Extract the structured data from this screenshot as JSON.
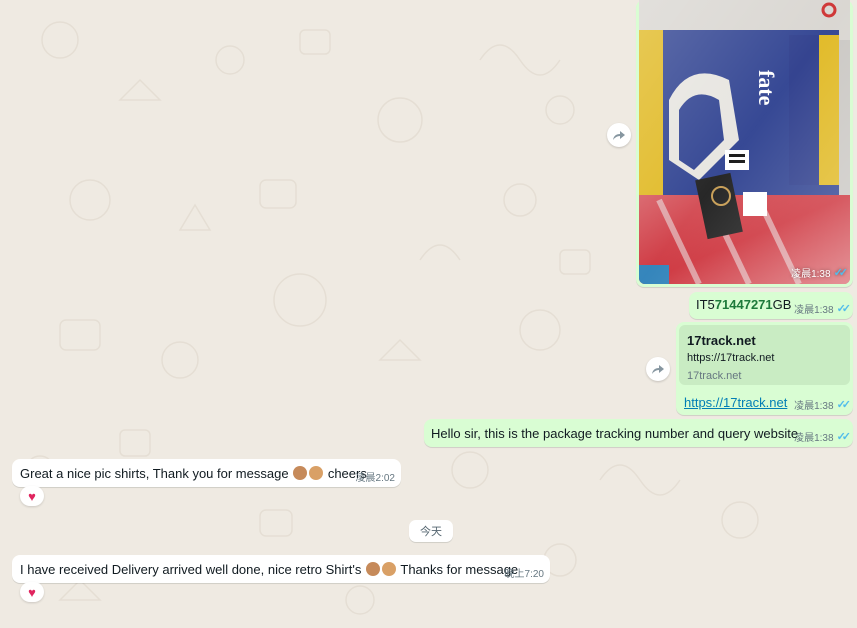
{
  "colors": {
    "outgoing": "#d9fdd3",
    "incoming": "#ffffff",
    "background": "#efeae2",
    "read_ticks": "#53bdeb",
    "link": "#027eb5"
  },
  "image_message": {
    "time": "凌晨1:38"
  },
  "tracking_message": {
    "prefix": "IT5",
    "number": "71447271",
    "suffix": "GB",
    "time": "凌晨1:38"
  },
  "link_preview": {
    "title": "17track.net",
    "url": "https://17track.net",
    "domain": "17track.net"
  },
  "link_message": {
    "link": "https://17track.net",
    "time": "凌晨1:38"
  },
  "greeting_message": {
    "text": "Hello sir, this is the package tracking number and query website",
    "time": "凌晨1:38"
  },
  "reply1": {
    "text_before": "Great a nice pic shirts, Thank you for message",
    "text_after": "cheers",
    "time": "凌晨2:02",
    "reaction": "heart"
  },
  "date_divider": "今天",
  "reply2": {
    "text_before": "I have received Delivery arrived well done, nice retro Shirt's",
    "text_after": "Thanks for message",
    "time": "晚上7:20",
    "reaction": "heart"
  },
  "icons": {
    "forward": "forward-icon",
    "reaction": "heart-icon",
    "read": "double-check-icon"
  }
}
